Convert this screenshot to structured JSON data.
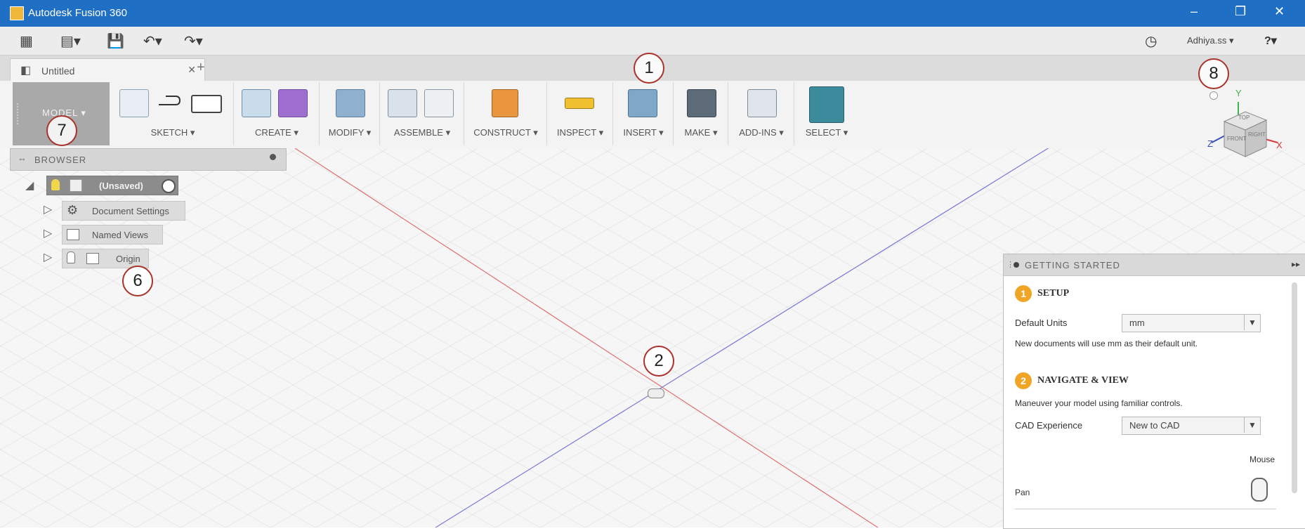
{
  "window": {
    "title": "Autodesk Fusion 360",
    "minimize": "–",
    "restore": "❐",
    "close": "✕"
  },
  "quick_access": {
    "user": "Adhiya.ss ▾",
    "help": "?▾"
  },
  "tabs": [
    {
      "label": "Untitled",
      "close": "✕"
    }
  ],
  "tab_add": "+",
  "toolbar": {
    "workspace_label": "MODEL ▾",
    "groups": [
      "SKETCH ▾",
      "CREATE ▾",
      "MODIFY ▾",
      "ASSEMBLE ▾",
      "CONSTRUCT ▾",
      "INSPECT ▾",
      "INSERT ▾",
      "MAKE ▾",
      "ADD-INS ▾",
      "SELECT ▾"
    ]
  },
  "browser": {
    "title": "BROWSER",
    "root": "(Unsaved)",
    "items": [
      "Document Settings",
      "Named Views",
      "Origin"
    ]
  },
  "getting_started": {
    "title": "GETTING STARTED",
    "setup_num": "1",
    "setup_title": "SETUP",
    "default_units_label": "Default Units",
    "default_units_value": "mm",
    "units_note": "New documents will use mm as their default unit.",
    "nav_num": "2",
    "nav_title": "NAVIGATE & VIEW",
    "nav_note": "Maneuver your model using familiar controls.",
    "cad_label": "CAD Experience",
    "cad_value": "New to CAD",
    "mouse_label": "Mouse",
    "pan_label": "Pan"
  },
  "viewcube": {
    "y": "Y",
    "z": "Z",
    "x": "X",
    "top": "TOP",
    "front": "FRONT",
    "right": "RIGHT"
  },
  "markers": [
    "1",
    "2",
    "6",
    "7",
    "8"
  ],
  "colors": {
    "titlebar": "#1f6fc5",
    "marker_ring": "#a8332b",
    "step_badge": "#f0a526",
    "axis_red": "#e07070",
    "axis_blue": "#7a7ad8",
    "select_tool": "#3b8b9c"
  }
}
